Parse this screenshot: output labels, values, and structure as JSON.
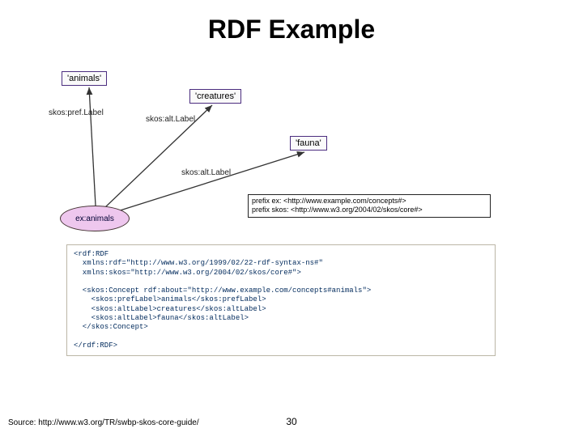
{
  "title": "RDF Example",
  "diagram": {
    "nodes": {
      "animals": "'animals'",
      "creatures": "'creatures'",
      "fauna": "'fauna'",
      "subject": "ex:animals"
    },
    "edges": {
      "prefLabel": "skos:pref.Label",
      "altLabel1": "skos:alt.Label",
      "altLabel2": "skos:alt.Label"
    },
    "prefixes": {
      "line1": "prefix ex: <http://www.example.com/concepts#>",
      "line2": "prefix skos: <http://www.w3.org/2004/02/skos/core#>"
    }
  },
  "code": "<rdf:RDF\n  xmlns:rdf=\"http://www.w3.org/1999/02/22-rdf-syntax-ns#\"\n  xmlns:skos=\"http://www.w3.org/2004/02/skos/core#\">\n\n  <skos:Concept rdf:about=\"http://www.example.com/concepts#animals\">\n    <skos:prefLabel>animals</skos:prefLabel>\n    <skos:altLabel>creatures</skos:altLabel>\n    <skos:altLabel>fauna</skos:altLabel>\n  </skos:Concept>\n\n</rdf:RDF>",
  "footer": {
    "source": "Source: http://www.w3.org/TR/swbp-skos-core-guide/",
    "page": "30"
  }
}
